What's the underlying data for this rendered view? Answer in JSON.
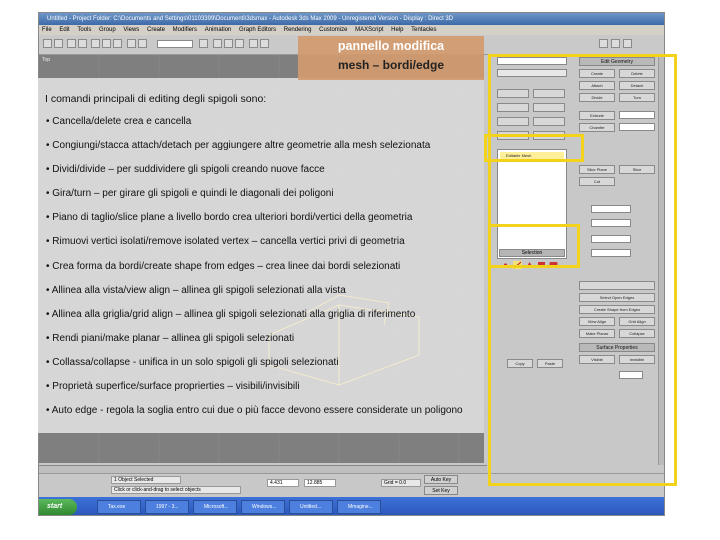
{
  "slide": {
    "title": "pannello modifica",
    "subtitle": "mesh – bordi/edge",
    "intro": "I comandi  principali di editing degli spigoli sono:",
    "bullets": [
      "• Cancella/delete crea e cancella",
      "• Congiungi/stacca attach/detach per aggiungere altre geometrie alla mesh selezionata",
      "• Dividi/divide – per suddividere gli spigoli creando nuove facce",
      "• Gira/turn – per girare gli spigoli e quindi le diagonali dei poligoni",
      "• Piano di taglio/slice plane a livello bordo crea ulteriori bordi/vertici della geometria",
      "• Rimuovi vertici isolati/remove isolated vertex – cancella vertici privi di geometria",
      "• Crea forma da bordi/create shape from edges – crea linee dai bordi selezionati",
      "• Allinea alla vista/view align – allinea gli spigoli selezionati alla vista",
      "• Allinea alla griglia/grid align – allinea gli spigoli selezionati alla griglia di riferimento",
      "• Rendi piani/make planar – allinea gli spigoli selezionati",
      "• Collassa/collapse  - unifica in un solo spigoli gli spigoli selezionati",
      "• Proprietà superfice/surface proprierties – visibili/invisibili",
      "• Auto edge -  regola la soglia entro cui due o più facce devono essere considerate un poligono"
    ]
  },
  "app": {
    "titlebar": "Untitled  - Project Folder: C:\\Documents and Settings\\01103399\\Documenti\\3dsmax  - Autodesk 3ds Max 2009  - Unregistered Version          - Display : Direct 3D",
    "menus": [
      "File",
      "Edit",
      "Tools",
      "Group",
      "Views",
      "Create",
      "Modifiers",
      "Animation",
      "Graph Editors",
      "Rendering",
      "Customize",
      "MAXScript",
      "Help",
      "Tentacles"
    ],
    "viewport_label": "Top",
    "modifier_stack_item": "Editable Mesh",
    "selection_label": "Selection",
    "command_panel": {
      "edit_geometry": "Edit Geometry",
      "surface_properties": "Surface Properties",
      "buttons": [
        "Create",
        "Delete",
        "Attach",
        "Detach",
        "Divide",
        "Turn",
        "Extrude",
        "Chamfer",
        "Slice Plane",
        "Slice",
        "Cut",
        "Select Open Edges",
        "Create Shape from Edges",
        "View Align",
        "Grid Align",
        "Make Planar",
        "Collapse",
        "Visible",
        "Invisible",
        "Copy",
        "Paste"
      ]
    },
    "status": {
      "selected": "1 Object Selected",
      "prompt": "Click or click-and-drag to select objects",
      "x": "4.431",
      "y": "12.885",
      "grid": "Grid = 0.0",
      "autokey": "Auto Key",
      "setkey": "Set Key"
    },
    "taskbar": {
      "start": "start",
      "items": [
        "Tax.exe",
        "1997 - 3...",
        "Microsoft...",
        "Windows...",
        "Untitled...",
        "Mmagine..."
      ]
    }
  }
}
